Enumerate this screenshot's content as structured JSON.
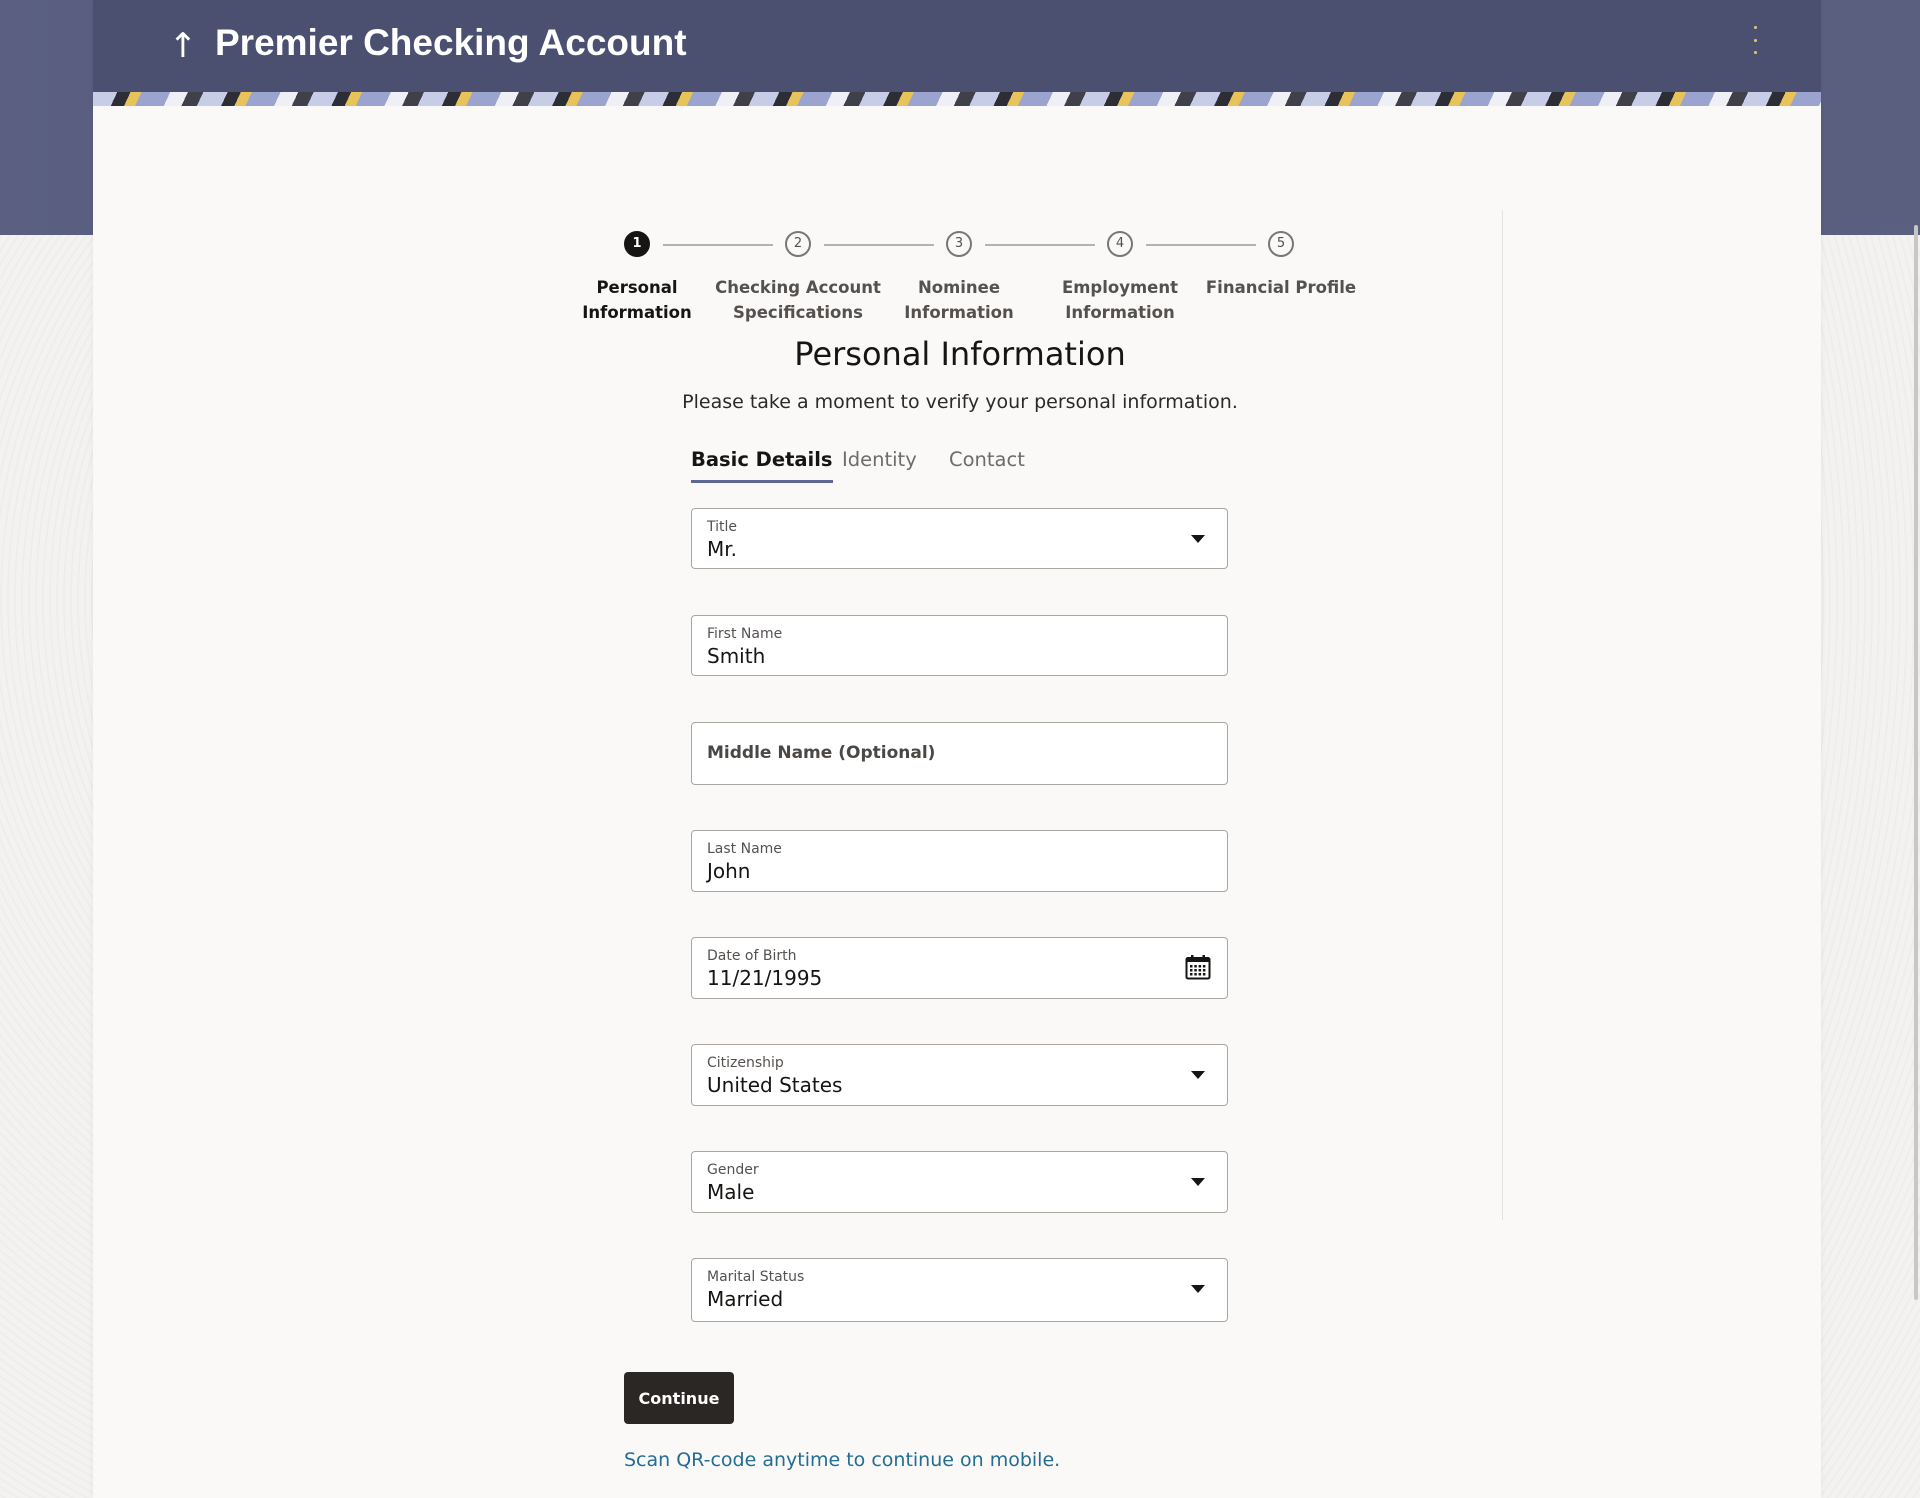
{
  "header": {
    "title": "Premier Checking Account",
    "back_icon": "arrow-up-icon",
    "menu_icon": "kebab-menu-icon"
  },
  "stepper": {
    "steps": [
      {
        "number": "1",
        "label_line1": "Personal",
        "label_line2": "Information",
        "active": true
      },
      {
        "number": "2",
        "label_line1": "Checking Account",
        "label_line2": "Specifications",
        "active": false
      },
      {
        "number": "3",
        "label_line1": "Nominee",
        "label_line2": "Information",
        "active": false
      },
      {
        "number": "4",
        "label_line1": "Employment",
        "label_line2": "Information",
        "active": false
      },
      {
        "number": "5",
        "label_line1": "Financial Profile",
        "label_line2": "",
        "active": false
      }
    ]
  },
  "section": {
    "title": "Personal Information",
    "subtitle": "Please take a moment to verify your personal information."
  },
  "tabs": {
    "basic": "Basic Details",
    "identity": "Identity",
    "contact": "Contact",
    "active": "Basic Details"
  },
  "form": {
    "title": {
      "label": "Title",
      "value": "Mr."
    },
    "first_name": {
      "label": "First Name",
      "value": "Smith"
    },
    "middle_name": {
      "placeholder": "Middle Name (Optional)"
    },
    "last_name": {
      "label": "Last Name",
      "value": "John"
    },
    "dob": {
      "label": "Date of Birth",
      "value": "11/21/1995",
      "icon": "calendar-icon"
    },
    "citizenship": {
      "label": "Citizenship",
      "value": "United States"
    },
    "gender": {
      "label": "Gender",
      "value": "Male"
    },
    "marital_status": {
      "label": "Marital Status",
      "value": "Married"
    }
  },
  "actions": {
    "continue": "Continue",
    "qr_link": "Scan QR-code anytime to continue on mobile."
  },
  "colors": {
    "header_bg": "#4b5071",
    "accent_underline": "#5d6795",
    "button_bg": "#2a2725",
    "link": "#236d93"
  }
}
